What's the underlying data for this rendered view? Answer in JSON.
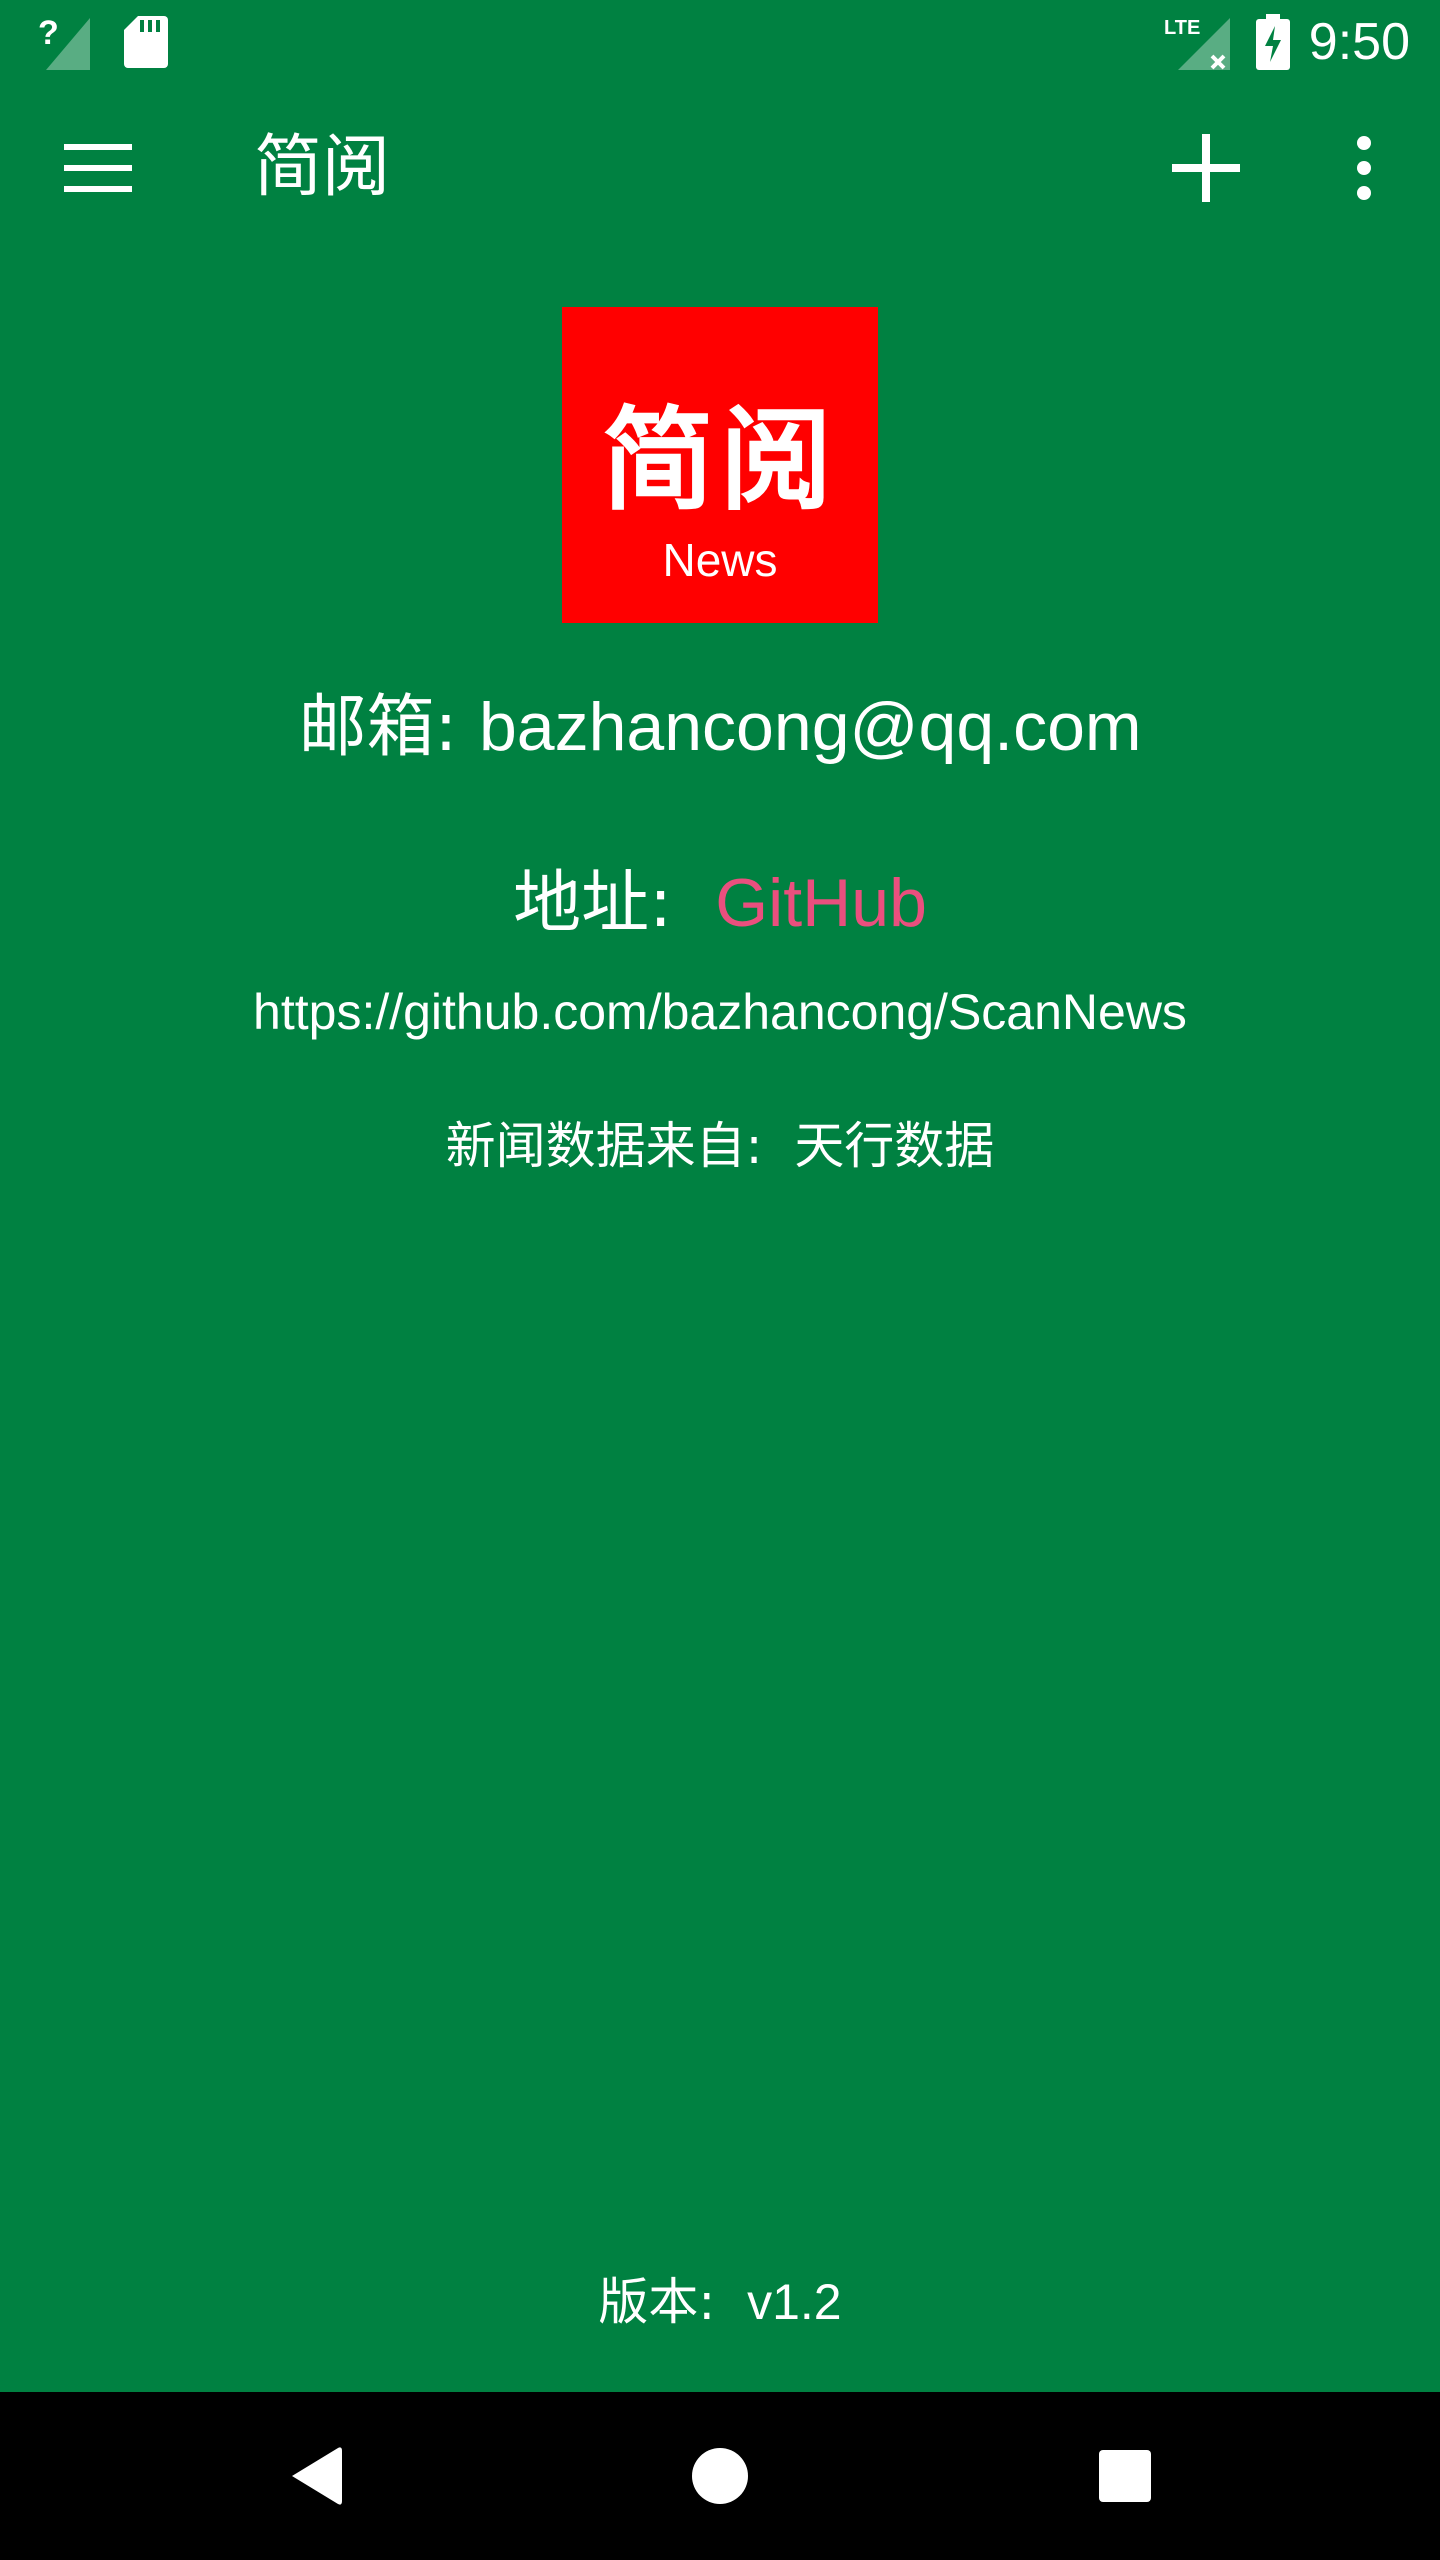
{
  "status_bar": {
    "time": "9:50",
    "icons": [
      "signal-unknown-icon",
      "sd-card-icon",
      "lte-signal-icon",
      "battery-charging-icon"
    ],
    "lte_label": "LTE"
  },
  "toolbar": {
    "title": "简阅",
    "icons": [
      "menu-icon",
      "add-icon",
      "more-vert-icon"
    ]
  },
  "logo": {
    "title": "简阅",
    "subtitle": "News",
    "background": "#ff0000"
  },
  "about": {
    "email_label": "邮箱: ",
    "email": "bazhancong@qq.com",
    "address_label": "地址:  ",
    "address_link": "GitHub",
    "url": "https://github.com/bazhancong/ScanNews",
    "source_label": "新闻数据来自:  ",
    "source_value": "天行数据",
    "version_label": "版本:  ",
    "version_value": "v1.2"
  },
  "nav_bar": {
    "icons": [
      "back-icon",
      "home-icon",
      "recents-icon"
    ]
  },
  "colors": {
    "background": "#008141",
    "link": "#ea4f7e",
    "nav_bar": "#000000"
  }
}
